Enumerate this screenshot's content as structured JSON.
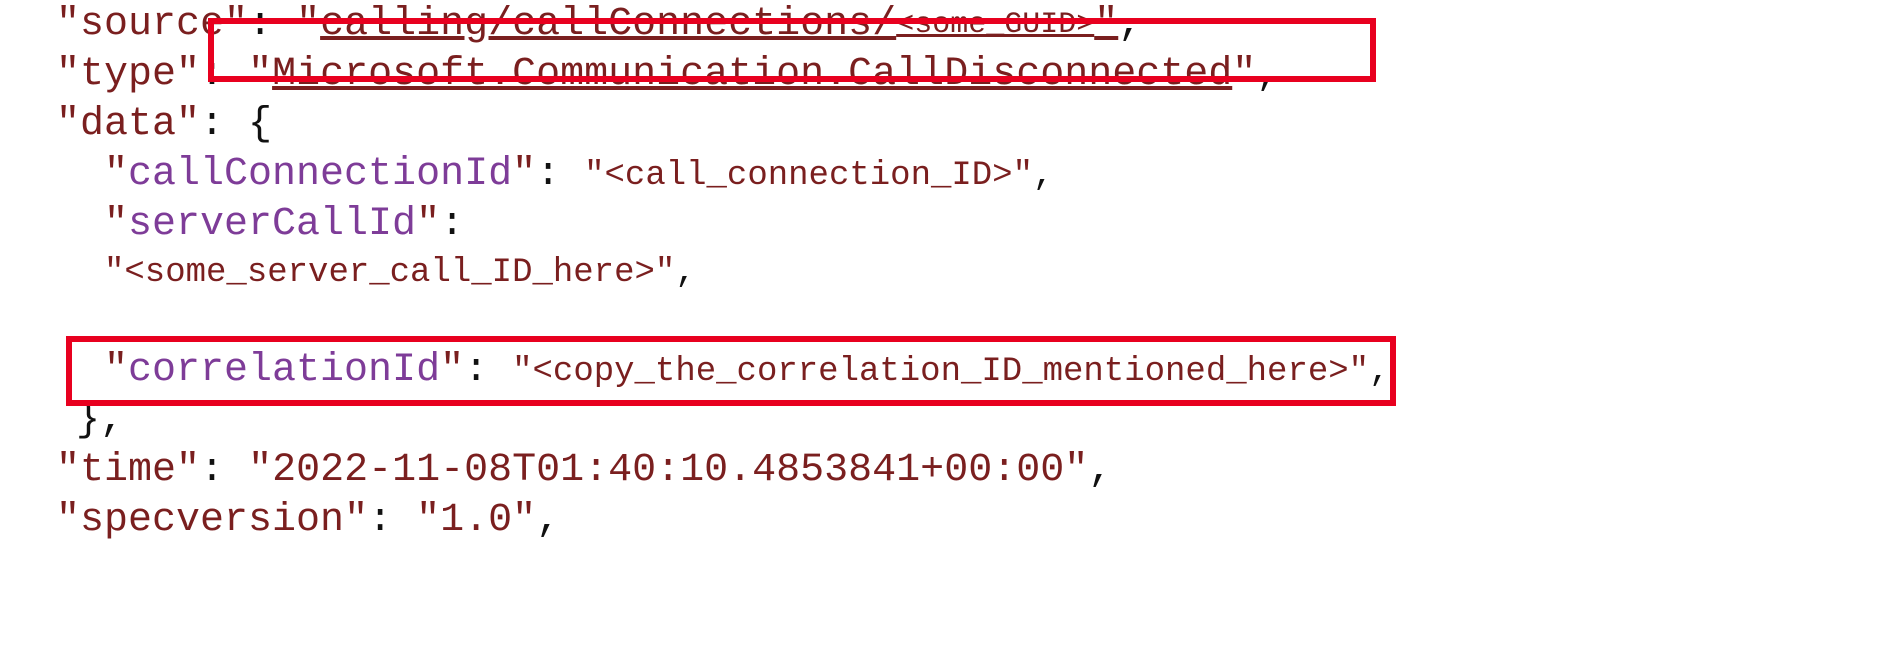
{
  "json_sample": {
    "source_key": "source",
    "source_val_prefix": "calling/callConnections/",
    "source_val_placeholder": "<some_GUID>",
    "type_key": "type",
    "type_val": "Microsoft.Communication.CallDisconnected",
    "data_key": "data",
    "callConnectionId_key": "callConnectionId",
    "callConnectionId_val": "<call_connection_ID>",
    "serverCallId_key": "serverCallId",
    "serverCallId_val": "<some_server_call_ID_here>",
    "correlationId_key": "correlationId",
    "correlationId_val": "<copy_the_correlation_ID_mentioned_here>",
    "time_key": "time",
    "time_val": "2022-11-08T01:40:10.4853841+00:00",
    "specversion_key": "specversion",
    "specversion_val": "1.0"
  }
}
